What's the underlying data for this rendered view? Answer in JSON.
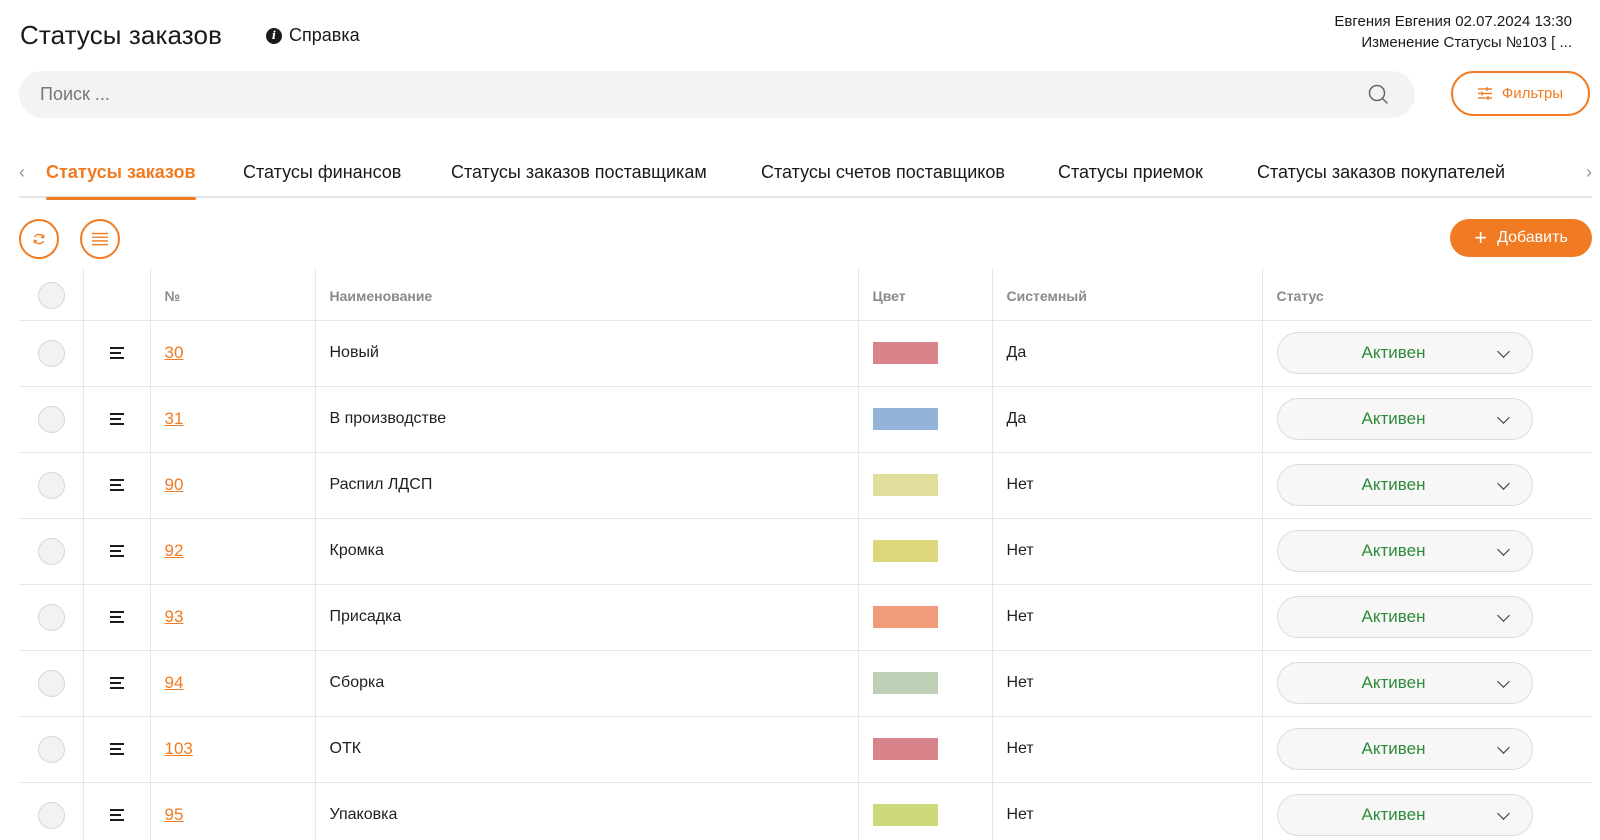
{
  "header": {
    "title": "Статусы заказов",
    "help_label": "Справка",
    "user_line": "Евгения Евгения 02.07.2024 13:30",
    "change_line": "Изменение Статусы №103 [ ..."
  },
  "search": {
    "placeholder": "Поиск ..."
  },
  "filters_label": "Фильтры",
  "tabs": [
    "Статусы заказов",
    "Статусы финансов",
    "Статусы заказов поставщикам",
    "Статусы счетов поставщиков",
    "Статусы приемок",
    "Статусы заказов покупателей"
  ],
  "add_label": "Добавить",
  "table": {
    "headers": [
      "№",
      "Наименование",
      "Цвет",
      "Системный",
      "Статус"
    ],
    "rows": [
      {
        "num": "30",
        "name": "Новый",
        "color": "#d9838b",
        "system": "Да",
        "status": "Активен"
      },
      {
        "num": "31",
        "name": "В производстве",
        "color": "#93b3d9",
        "system": "Да",
        "status": "Активен"
      },
      {
        "num": "90",
        "name": "Распил ЛДСП",
        "color": "#e0de9a",
        "system": "Нет",
        "status": "Активен"
      },
      {
        "num": "92",
        "name": "Кромка",
        "color": "#ddd77b",
        "system": "Нет",
        "status": "Активен"
      },
      {
        "num": "93",
        "name": "Присадка",
        "color": "#f29b7b",
        "system": "Нет",
        "status": "Активен"
      },
      {
        "num": "94",
        "name": "Сборка",
        "color": "#bfcfb5",
        "system": "Нет",
        "status": "Активен"
      },
      {
        "num": "103",
        "name": "ОТК",
        "color": "#d9838b",
        "system": "Нет",
        "status": "Активен"
      },
      {
        "num": "95",
        "name": "Упаковка",
        "color": "#cdd97b",
        "system": "Нет",
        "status": "Активен"
      }
    ]
  },
  "colors": {
    "accent": "#f07b22",
    "status_text": "#2e8b3a"
  }
}
